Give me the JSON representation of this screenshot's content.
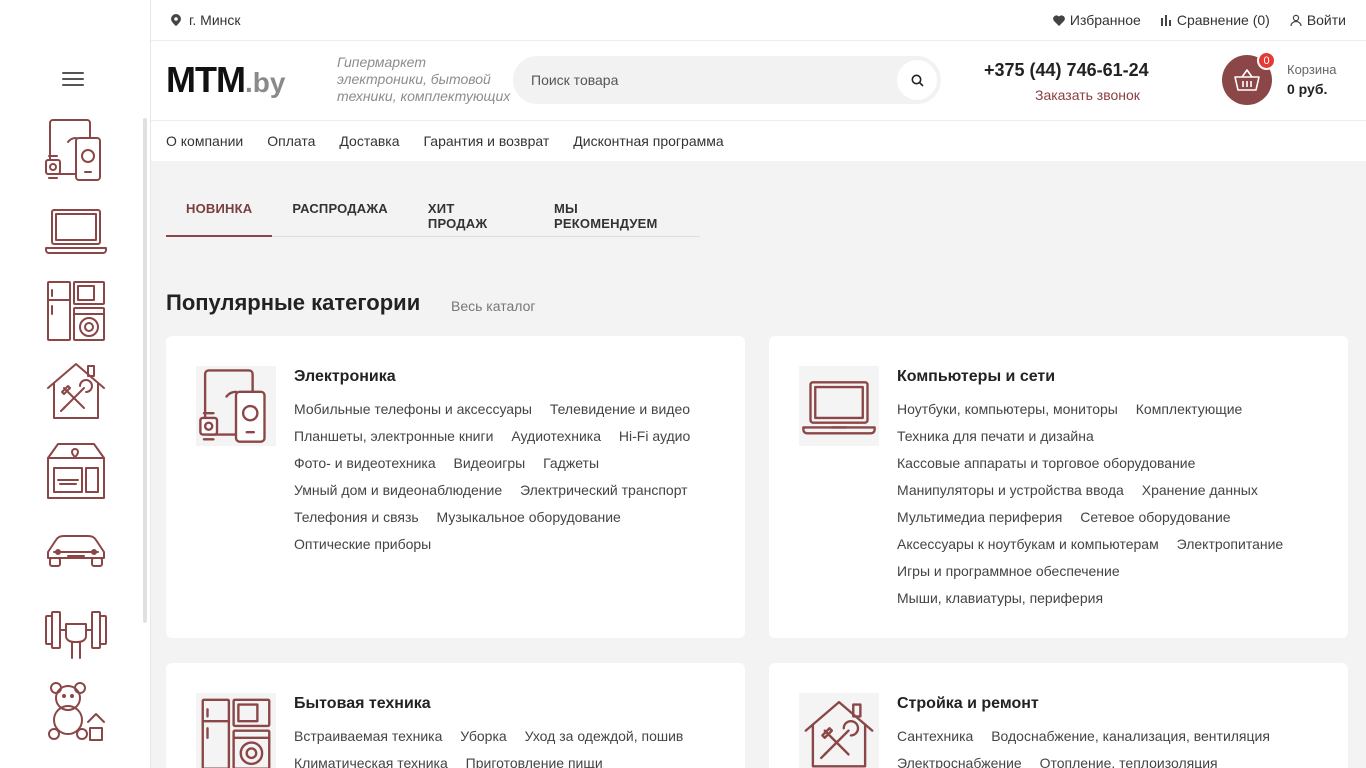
{
  "colors": {
    "accent": "#8b4747",
    "badge": "#e53935"
  },
  "topbar": {
    "city": "г. Минск",
    "favorites": "Избранное",
    "compare": "Сравнение (0)",
    "login": "Войти"
  },
  "header": {
    "logo_main": "MTM",
    "logo_suffix": ".by",
    "tagline": "Гипермаркет электроники, бытовой техники, комплектующих",
    "search_placeholder": "Поиск товара",
    "phone": "+375 (44) 746-61-24",
    "callback": "Заказать звонок",
    "cart_badge": "0",
    "cart_label": "Корзина",
    "cart_sum": "0 руб."
  },
  "nav": [
    "О компании",
    "Оплата",
    "Доставка",
    "Гарантия и возврат",
    "Дисконтная программа"
  ],
  "tabs": [
    "НОВИНКА",
    "РАСПРОДАЖА",
    "ХИТ ПРОДАЖ",
    "МЫ РЕКОМЕНДУЕМ"
  ],
  "section": {
    "title": "Популярные категории",
    "all_link": "Весь каталог"
  },
  "sidebar_icons": [
    "devices-icon",
    "laptop-icon",
    "appliances-icon",
    "house-repair-icon",
    "furniture-icon",
    "car-icon",
    "fitness-icon",
    "toys-icon"
  ],
  "categories": [
    {
      "title": "Электроника",
      "icon": "devices-icon",
      "links": [
        "Мобильные телефоны и аксессуары",
        "Телевидение и видео",
        "Планшеты, электронные книги",
        "Аудиотехника",
        "Hi-Fi аудио",
        "Фото- и видеотехника",
        "Видеоигры",
        "Гаджеты",
        "Умный дом и видеонаблюдение",
        "Электрический транспорт",
        "Телефония и связь",
        "Музыкальное оборудование",
        "Оптические приборы"
      ]
    },
    {
      "title": "Компьютеры и сети",
      "icon": "laptop-icon",
      "links": [
        "Ноутбуки, компьютеры, мониторы",
        "Комплектующие",
        "Техника для печати и дизайна",
        "Кассовые аппараты и торговое оборудование",
        "Манипуляторы и устройства ввода",
        "Хранение данных",
        "Мультимедиа периферия",
        "Сетевое оборудование",
        "Аксессуары к ноутбукам и компьютерам",
        "Электропитание",
        "Игры и программное обеспечение",
        "Мыши, клавиатуры, периферия"
      ]
    },
    {
      "title": "Бытовая техника",
      "icon": "appliances-icon",
      "links": [
        "Встраиваемая техника",
        "Уборка",
        "Уход за одеждой, пошив",
        "Климатическая техника",
        "Приготовление пищи"
      ]
    },
    {
      "title": "Стройка и ремонт",
      "icon": "house-repair-icon",
      "links": [
        "Сантехника",
        "Водоснабжение, канализация, вентиляция",
        "Электроснабжение",
        "Отопление, теплоизоляция"
      ]
    }
  ]
}
